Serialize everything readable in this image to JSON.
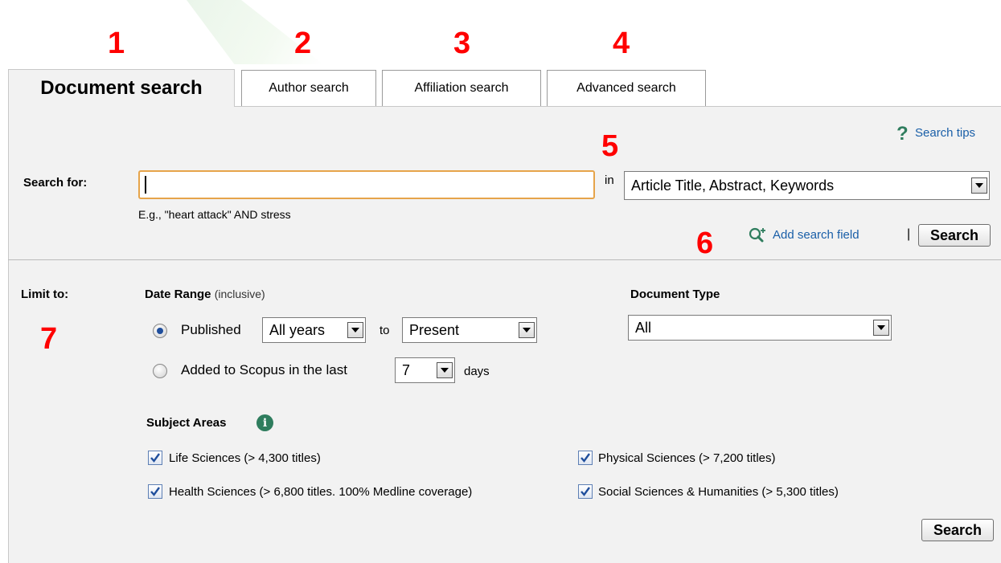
{
  "annotations": {
    "n1": "1",
    "n2": "2",
    "n3": "3",
    "n4": "4",
    "n5": "5",
    "n6": "6",
    "n7": "7"
  },
  "tabs": [
    {
      "label": "Document search",
      "active": true
    },
    {
      "label": "Author search",
      "active": false
    },
    {
      "label": "Affiliation search",
      "active": false
    },
    {
      "label": "Advanced search",
      "active": false
    }
  ],
  "search": {
    "tips_label": "Search tips",
    "search_for_label": "Search for:",
    "query_value": "",
    "example_text": "E.g., \"heart attack\" AND stress",
    "in_label": "in",
    "field_selected": "Article Title, Abstract, Keywords",
    "add_field_label": "Add search field",
    "separator": "|",
    "search_button": "Search"
  },
  "limits": {
    "limit_label": "Limit to:",
    "date_range_label": "Date Range",
    "date_range_note": "(inclusive)",
    "published_label": "Published",
    "from_selected": "All years",
    "to_label": "to",
    "to_selected": "Present",
    "added_label": "Added to Scopus in the last",
    "days_selected": "7",
    "days_label": "days",
    "doc_type_label": "Document Type",
    "doc_type_selected": "All",
    "subject_areas_label": "Subject Areas",
    "subjects": [
      {
        "label": "Life Sciences (> 4,300 titles)",
        "checked": true
      },
      {
        "label": "Physical Sciences (> 7,200 titles)",
        "checked": true
      },
      {
        "label": "Health Sciences (> 6,800 titles. 100% Medline coverage)",
        "checked": true
      },
      {
        "label": "Social Sciences & Humanities (> 5,300 titles)",
        "checked": true
      }
    ],
    "search_button": "Search"
  },
  "colors": {
    "annotation": "#ff0000",
    "link": "#1a5fa8",
    "panel_bg": "#f2f2f2",
    "input_border": "#e6a44a",
    "icon_green": "#2f7d5e"
  }
}
